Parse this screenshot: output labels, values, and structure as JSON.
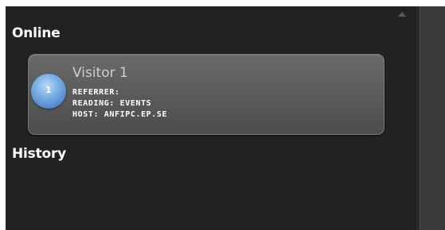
{
  "online": {
    "title": "Online",
    "visitors": [
      {
        "avatar_number": "1",
        "name": "Visitor 1",
        "referrer": "REFERRER:",
        "reading": "READING: EVENTS",
        "host": "HOST: ANFIPC.EP.SE"
      }
    ]
  },
  "history": {
    "title": "History"
  },
  "icons": {
    "scroll_up": "scroll-up-arrow-icon"
  },
  "colors": {
    "panel_background": "#222222",
    "card_background": "#5c5c5c",
    "avatar_blue": "#4f88cc"
  }
}
